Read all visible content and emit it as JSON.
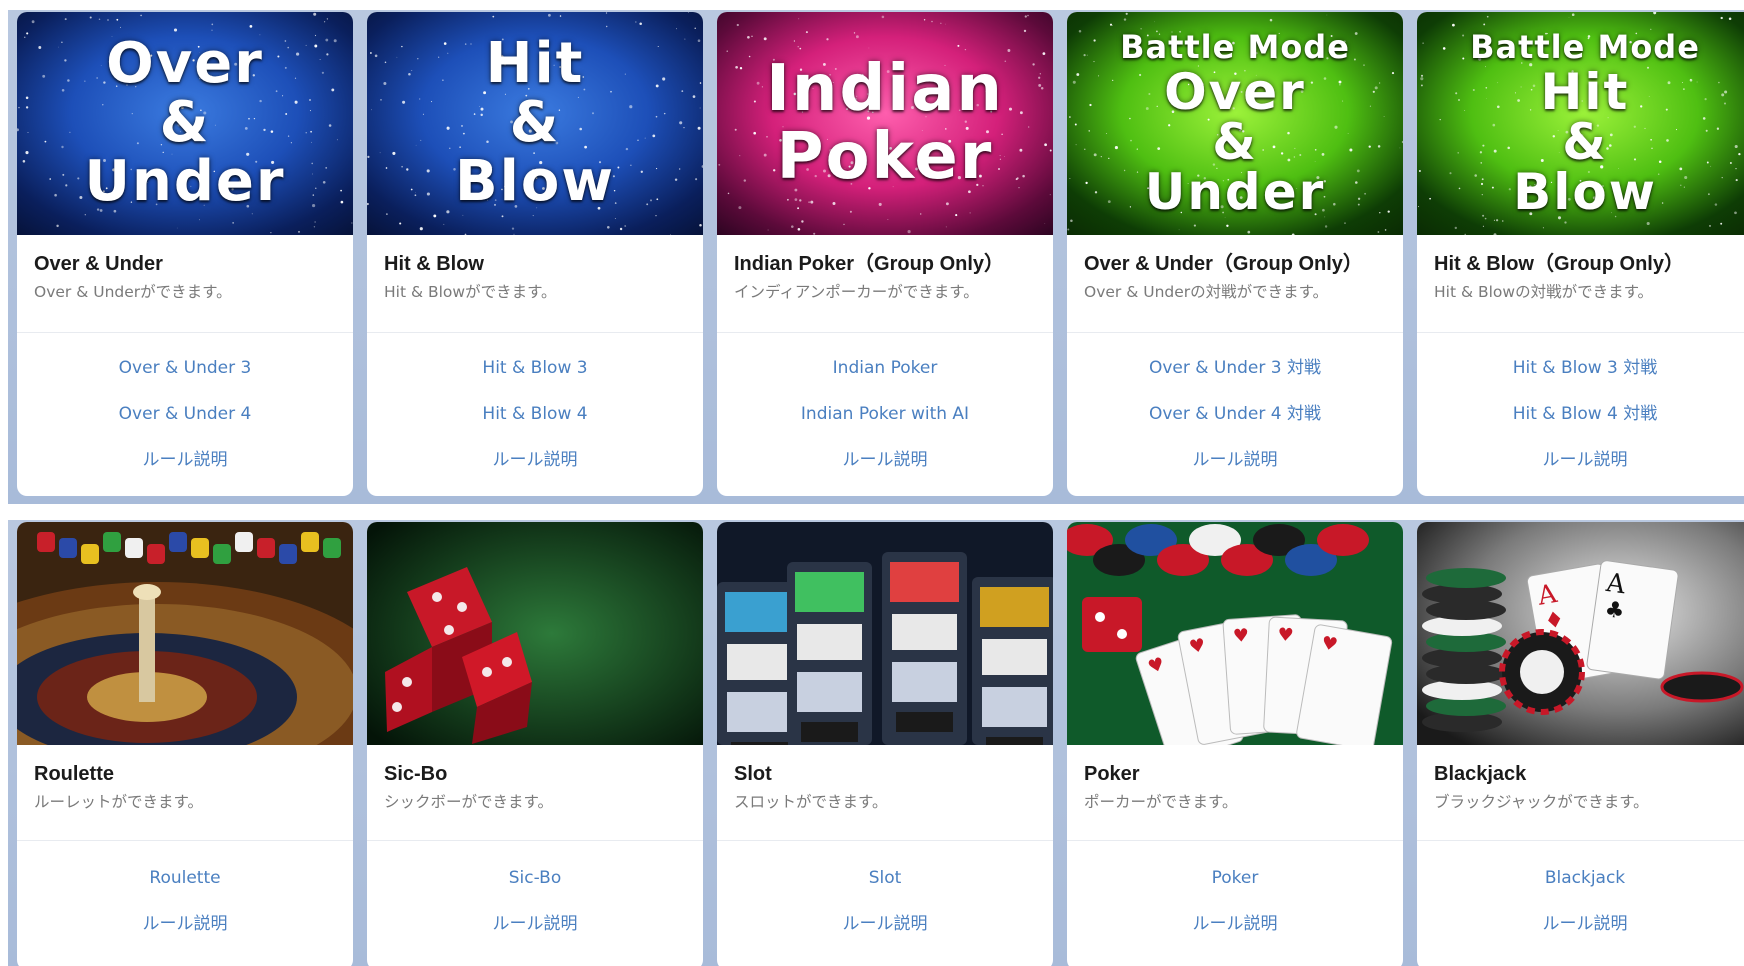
{
  "row1": [
    {
      "art": [
        "Over",
        "&",
        "Under"
      ],
      "art_sub": "",
      "theme": "blue",
      "title": "Over & Under",
      "desc": "Over & Underができます。",
      "links": [
        "Over & Under 3",
        "Over & Under 4",
        "ルール説明"
      ]
    },
    {
      "art": [
        "Hit",
        "&",
        "Blow"
      ],
      "art_sub": "",
      "theme": "blue",
      "title": "Hit & Blow",
      "desc": "Hit & Blowができます。",
      "links": [
        "Hit & Blow 3",
        "Hit & Blow 4",
        "ルール説明"
      ]
    },
    {
      "art": [
        "Indian",
        "Poker"
      ],
      "art_sub": "",
      "theme": "pink",
      "title": "Indian Poker（Group Only）",
      "desc": "インディアンポーカーができます。",
      "links": [
        "Indian Poker",
        "Indian Poker with AI",
        "ルール説明"
      ]
    },
    {
      "art": [
        "Over",
        "&",
        "Under"
      ],
      "art_sub": "Battle Mode",
      "theme": "green",
      "title": "Over & Under（Group Only）",
      "desc": "Over & Underの対戦ができます。",
      "links": [
        "Over & Under 3 対戦",
        "Over & Under 4 対戦",
        "ルール説明"
      ]
    },
    {
      "art": [
        "Hit",
        "&",
        "Blow"
      ],
      "art_sub": "Battle Mode",
      "theme": "green",
      "title": "Hit & Blow（Group Only）",
      "desc": "Hit & Blowの対戦ができます。",
      "links": [
        "Hit & Blow 3 対戦",
        "Hit & Blow 4 対戦",
        "ルール説明"
      ]
    }
  ],
  "row2": [
    {
      "scene": "roulette",
      "title": "Roulette",
      "desc": "ルーレットができます。",
      "links": [
        "Roulette",
        "ルール説明"
      ]
    },
    {
      "scene": "dice",
      "title": "Sic-Bo",
      "desc": "シックボーができます。",
      "links": [
        "Sic-Bo",
        "ルール説明"
      ]
    },
    {
      "scene": "slot",
      "title": "Slot",
      "desc": "スロットができます。",
      "links": [
        "Slot",
        "ルール説明"
      ]
    },
    {
      "scene": "poker",
      "title": "Poker",
      "desc": "ポーカーができます。",
      "links": [
        "Poker",
        "ルール説明"
      ]
    },
    {
      "scene": "blackjack",
      "title": "Blackjack",
      "desc": "ブラックジャックができます。",
      "links": [
        "Blackjack",
        "ルール説明"
      ]
    }
  ],
  "colors": {
    "link": "#4a7fc0",
    "title": "#1b1b1b",
    "desc": "#7a7a7a",
    "panel_bg": "#b9c8e0"
  }
}
